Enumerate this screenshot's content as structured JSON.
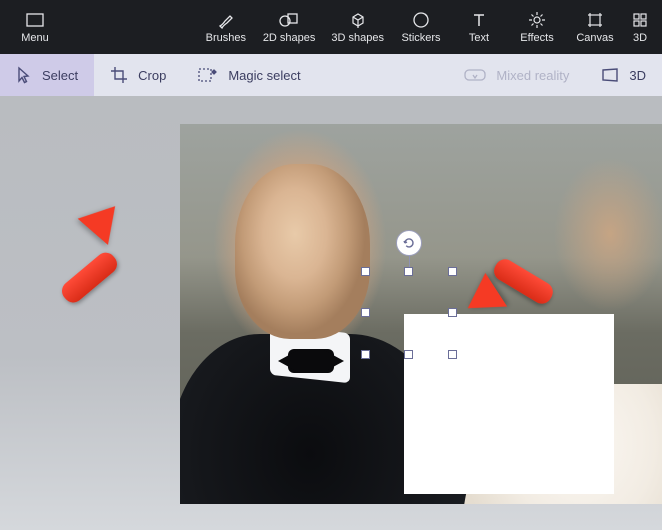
{
  "topbar": {
    "menu": "Menu",
    "items": [
      {
        "label": "Brushes"
      },
      {
        "label": "2D shapes"
      },
      {
        "label": "3D shapes"
      },
      {
        "label": "Stickers"
      },
      {
        "label": "Text"
      },
      {
        "label": "Effects"
      },
      {
        "label": "Canvas"
      },
      {
        "label": "3D"
      }
    ]
  },
  "subbar": {
    "select": "Select",
    "crop": "Crop",
    "magic_select": "Magic select",
    "mixed_reality": "Mixed reality",
    "three_d": "3D"
  }
}
